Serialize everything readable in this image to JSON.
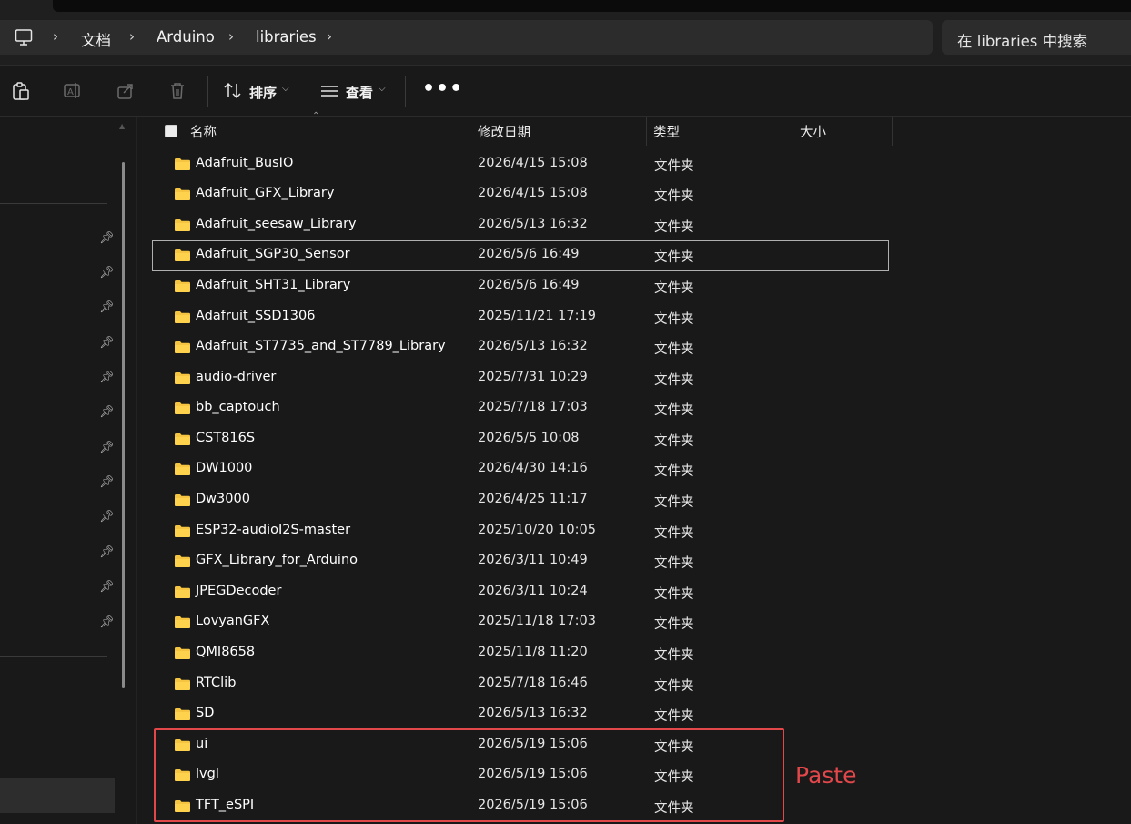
{
  "address": {
    "breadcrumbs": [
      "文档",
      "Arduino",
      "libraries"
    ],
    "search_placeholder": "在 libraries 中搜索"
  },
  "toolbar": {
    "sort_label": "排序",
    "view_label": "查看"
  },
  "columns": {
    "name": "名称",
    "date": "修改日期",
    "type": "类型",
    "size": "大小"
  },
  "files": [
    {
      "name": "Adafruit_BusIO",
      "date": "2026/4/15 15:08",
      "type": "文件夹"
    },
    {
      "name": "Adafruit_GFX_Library",
      "date": "2026/4/15 15:08",
      "type": "文件夹"
    },
    {
      "name": "Adafruit_seesaw_Library",
      "date": "2026/5/13 16:32",
      "type": "文件夹"
    },
    {
      "name": "Adafruit_SGP30_Sensor",
      "date": "2026/5/6 16:49",
      "type": "文件夹"
    },
    {
      "name": "Adafruit_SHT31_Library",
      "date": "2026/5/6 16:49",
      "type": "文件夹"
    },
    {
      "name": "Adafruit_SSD1306",
      "date": "2025/11/21 17:19",
      "type": "文件夹"
    },
    {
      "name": "Adafruit_ST7735_and_ST7789_Library",
      "date": "2026/5/13 16:32",
      "type": "文件夹"
    },
    {
      "name": "audio-driver",
      "date": "2025/7/31 10:29",
      "type": "文件夹"
    },
    {
      "name": "bb_captouch",
      "date": "2025/7/18 17:03",
      "type": "文件夹"
    },
    {
      "name": "CST816S",
      "date": "2026/5/5 10:08",
      "type": "文件夹"
    },
    {
      "name": "DW1000",
      "date": "2026/4/30 14:16",
      "type": "文件夹"
    },
    {
      "name": "Dw3000",
      "date": "2026/4/25 11:17",
      "type": "文件夹"
    },
    {
      "name": "ESP32-audioI2S-master",
      "date": "2025/10/20 10:05",
      "type": "文件夹"
    },
    {
      "name": "GFX_Library_for_Arduino",
      "date": "2026/3/11 10:49",
      "type": "文件夹"
    },
    {
      "name": "JPEGDecoder",
      "date": "2026/3/11 10:24",
      "type": "文件夹"
    },
    {
      "name": "LovyanGFX",
      "date": "2025/11/18 17:03",
      "type": "文件夹"
    },
    {
      "name": "QMI8658",
      "date": "2025/11/8 11:20",
      "type": "文件夹"
    },
    {
      "name": "RTClib",
      "date": "2025/7/18 16:46",
      "type": "文件夹"
    },
    {
      "name": "SD",
      "date": "2026/5/13 16:32",
      "type": "文件夹"
    },
    {
      "name": "ui",
      "date": "2026/5/19 15:06",
      "type": "文件夹"
    },
    {
      "name": "lvgl",
      "date": "2026/5/19 15:06",
      "type": "文件夹"
    },
    {
      "name": "TFT_eSPI",
      "date": "2026/5/19 15:06",
      "type": "文件夹"
    }
  ],
  "focused_row": "Adafruit_SGP30_Sensor",
  "annotation": {
    "label": "Paste",
    "color": "#e2474a"
  },
  "colors": {
    "folder": "#f5c542",
    "background": "#191919",
    "address_bg": "#2c2c2c"
  },
  "icons": {
    "address": "computer-icon",
    "toolbar": [
      "paste-icon",
      "rename-icon",
      "share-icon",
      "delete-icon",
      "sort-icon",
      "view-icon",
      "more-icon"
    ]
  }
}
